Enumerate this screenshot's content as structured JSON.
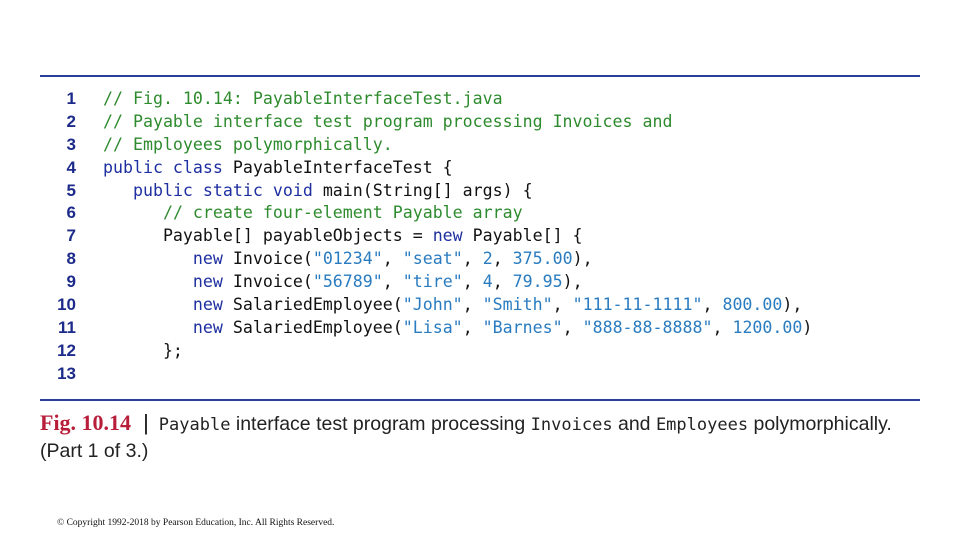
{
  "code": {
    "line_numbers": [
      "1",
      "2",
      "3",
      "4",
      "5",
      "6",
      "7",
      "8",
      "9",
      "10",
      "11",
      "12",
      "13"
    ],
    "lines": [
      [
        {
          "t": "cm",
          "s": "// Fig. 10.14: PayableInterfaceTest.java"
        }
      ],
      [
        {
          "t": "cm",
          "s": "// Payable interface test program processing Invoices and"
        }
      ],
      [
        {
          "t": "cm",
          "s": "// Employees polymorphically."
        }
      ],
      [
        {
          "t": "kw",
          "s": "public class "
        },
        {
          "t": "pl",
          "s": "PayableInterfaceTest {"
        }
      ],
      [
        {
          "t": "pl",
          "s": "   "
        },
        {
          "t": "kw",
          "s": "public static void "
        },
        {
          "t": "pl",
          "s": "main(String[] args) {"
        }
      ],
      [
        {
          "t": "pl",
          "s": "      "
        },
        {
          "t": "cm",
          "s": "// create four-element Payable array"
        }
      ],
      [
        {
          "t": "pl",
          "s": "      Payable[] payableObjects = "
        },
        {
          "t": "kw",
          "s": "new "
        },
        {
          "t": "pl",
          "s": "Payable[] {"
        }
      ],
      [
        {
          "t": "pl",
          "s": "         "
        },
        {
          "t": "kw",
          "s": "new "
        },
        {
          "t": "pl",
          "s": "Invoice("
        },
        {
          "t": "lit",
          "s": "\"01234\""
        },
        {
          "t": "pl",
          "s": ", "
        },
        {
          "t": "lit",
          "s": "\"seat\""
        },
        {
          "t": "pl",
          "s": ", "
        },
        {
          "t": "lit",
          "s": "2"
        },
        {
          "t": "pl",
          "s": ", "
        },
        {
          "t": "lit",
          "s": "375.00"
        },
        {
          "t": "pl",
          "s": "),"
        }
      ],
      [
        {
          "t": "pl",
          "s": "         "
        },
        {
          "t": "kw",
          "s": "new "
        },
        {
          "t": "pl",
          "s": "Invoice("
        },
        {
          "t": "lit",
          "s": "\"56789\""
        },
        {
          "t": "pl",
          "s": ", "
        },
        {
          "t": "lit",
          "s": "\"tire\""
        },
        {
          "t": "pl",
          "s": ", "
        },
        {
          "t": "lit",
          "s": "4"
        },
        {
          "t": "pl",
          "s": ", "
        },
        {
          "t": "lit",
          "s": "79.95"
        },
        {
          "t": "pl",
          "s": "),"
        }
      ],
      [
        {
          "t": "pl",
          "s": "         "
        },
        {
          "t": "kw",
          "s": "new "
        },
        {
          "t": "pl",
          "s": "SalariedEmployee("
        },
        {
          "t": "lit",
          "s": "\"John\""
        },
        {
          "t": "pl",
          "s": ", "
        },
        {
          "t": "lit",
          "s": "\"Smith\""
        },
        {
          "t": "pl",
          "s": ", "
        },
        {
          "t": "lit",
          "s": "\"111-11-1111\""
        },
        {
          "t": "pl",
          "s": ", "
        },
        {
          "t": "lit",
          "s": "800.00"
        },
        {
          "t": "pl",
          "s": "),"
        }
      ],
      [
        {
          "t": "pl",
          "s": "         "
        },
        {
          "t": "kw",
          "s": "new "
        },
        {
          "t": "pl",
          "s": "SalariedEmployee("
        },
        {
          "t": "lit",
          "s": "\"Lisa\""
        },
        {
          "t": "pl",
          "s": ", "
        },
        {
          "t": "lit",
          "s": "\"Barnes\""
        },
        {
          "t": "pl",
          "s": ", "
        },
        {
          "t": "lit",
          "s": "\"888-88-8888\""
        },
        {
          "t": "pl",
          "s": ", "
        },
        {
          "t": "lit",
          "s": "1200.00"
        },
        {
          "t": "pl",
          "s": ")"
        }
      ],
      [
        {
          "t": "pl",
          "s": "      };"
        }
      ],
      []
    ]
  },
  "caption": {
    "fig_label": "Fig. 10.14",
    "separator": "|",
    "part1_mono": "Payable",
    "part2": " interface test program processing ",
    "part3_mono": "Invoices",
    "part4": " and ",
    "part5_mono": "Employees",
    "part6": " polymorphically. (Part 1 of 3.)"
  },
  "footer": {
    "copyright": "© Copyright 1992-2018 by Pearson Education, Inc. All Rights Reserved."
  },
  "colors": {
    "rule": "#2b3f9a",
    "line_number": "#1c2b8a",
    "comment": "#2e8b2e",
    "keyword": "#1e2fa0",
    "literal": "#2a7cc0",
    "fig_label": "#b81e3a"
  }
}
